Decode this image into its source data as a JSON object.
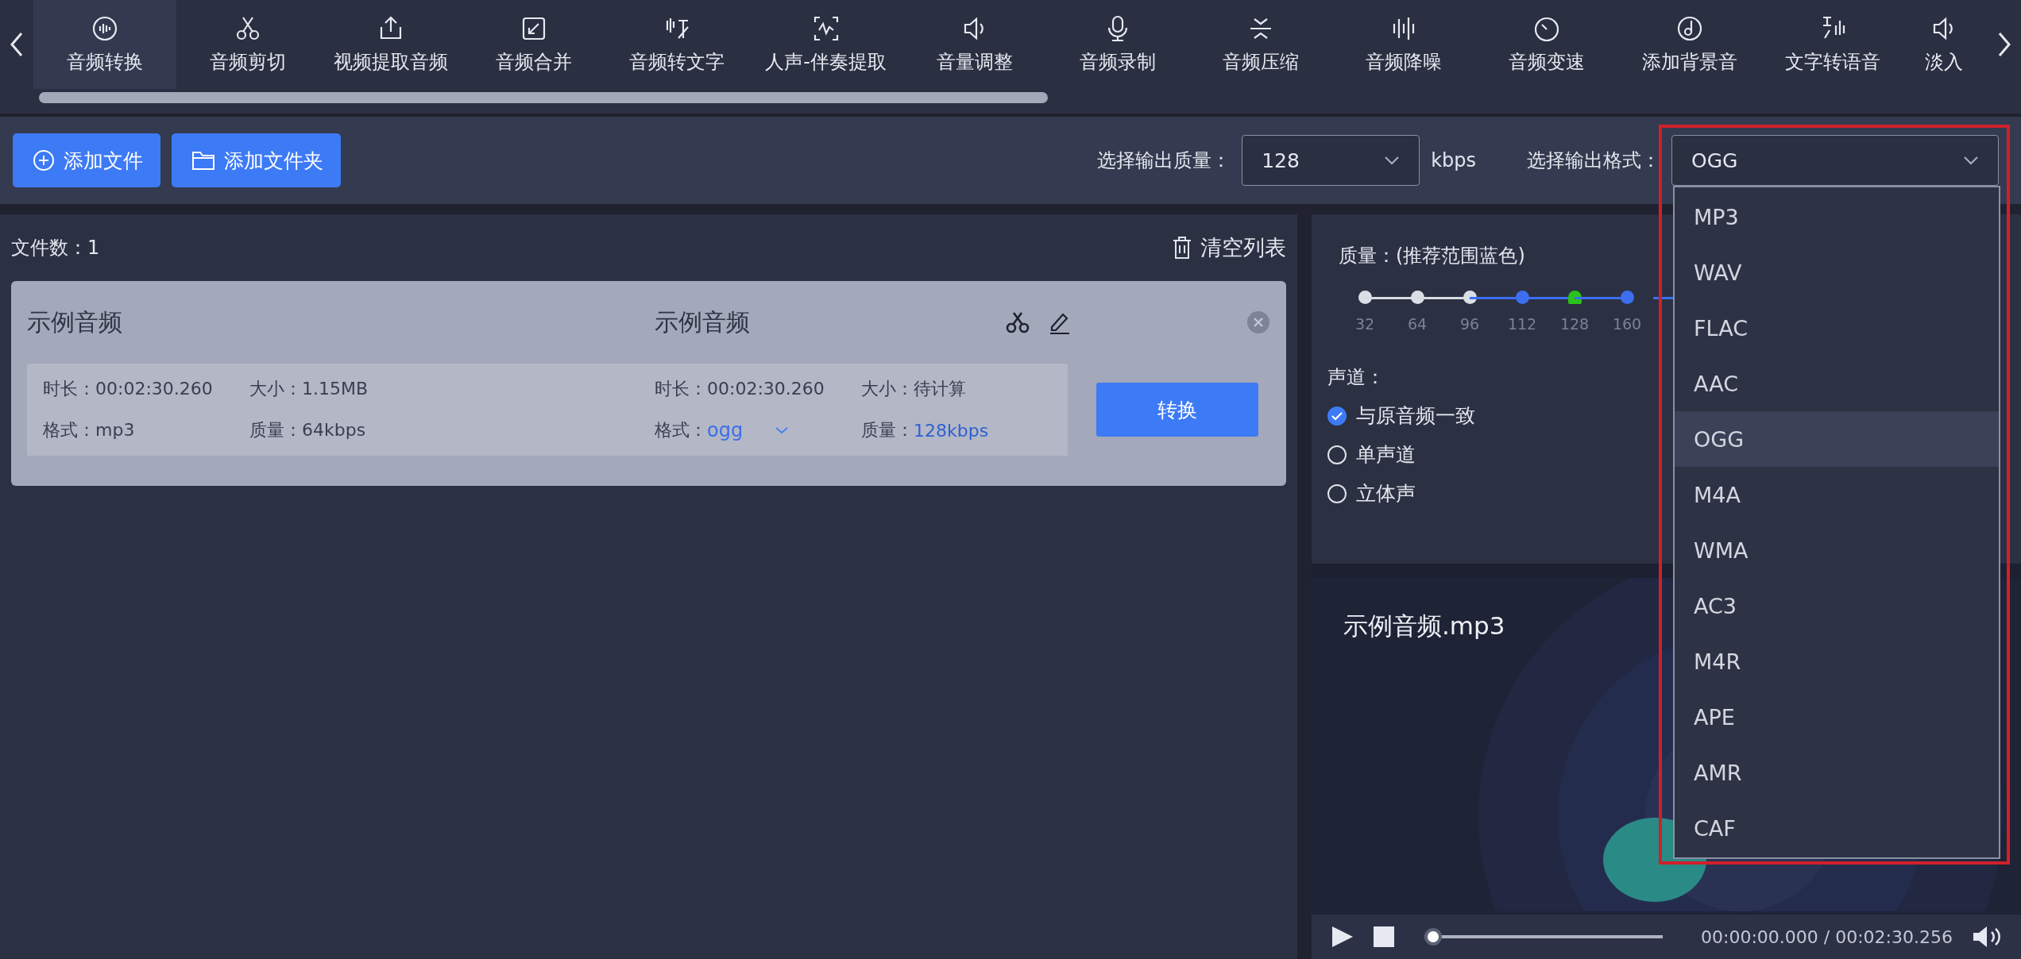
{
  "nav": {
    "tabs": [
      {
        "label": "音频转换",
        "selected": true
      },
      {
        "label": "音频剪切",
        "selected": false
      },
      {
        "label": "视频提取音频",
        "selected": false
      },
      {
        "label": "音频合并",
        "selected": false
      },
      {
        "label": "音频转文字",
        "selected": false
      },
      {
        "label": "人声-伴奏提取",
        "selected": false
      },
      {
        "label": "音量调整",
        "selected": false
      },
      {
        "label": "音频录制",
        "selected": false
      },
      {
        "label": "音频压缩",
        "selected": false
      },
      {
        "label": "音频降噪",
        "selected": false
      },
      {
        "label": "音频变速",
        "selected": false
      },
      {
        "label": "添加背景音",
        "selected": false
      },
      {
        "label": "文字转语音",
        "selected": false
      },
      {
        "label": "淡入",
        "selected": false
      }
    ]
  },
  "toolbar": {
    "add_file": "添加文件",
    "add_folder": "添加文件夹",
    "quality_label": "选择输出质量：",
    "quality_value": "128",
    "quality_unit": "kbps",
    "format_label": "选择输出格式：",
    "format_value": "OGG",
    "format_options": [
      {
        "label": "MP3",
        "selected": false
      },
      {
        "label": "WAV",
        "selected": false
      },
      {
        "label": "FLAC",
        "selected": false
      },
      {
        "label": "AAC",
        "selected": false
      },
      {
        "label": "OGG",
        "selected": true
      },
      {
        "label": "M4A",
        "selected": false
      },
      {
        "label": "WMA",
        "selected": false
      },
      {
        "label": "AC3",
        "selected": false
      },
      {
        "label": "M4R",
        "selected": false
      },
      {
        "label": "APE",
        "selected": false
      },
      {
        "label": "AMR",
        "selected": false
      },
      {
        "label": "CAF",
        "selected": false
      }
    ]
  },
  "file_list": {
    "count": "文件数：1",
    "clear": "清空列表",
    "files": [
      {
        "source": {
          "name": "示例音频",
          "duration": "时长：00:02:30.260",
          "size": "大小：1.15MB",
          "format": "格式：mp3",
          "quality": "质量：64kbps"
        },
        "target": {
          "name": "示例音频",
          "duration": "时长：00:02:30.260",
          "size": "大小：待计算",
          "format_label": "格式：",
          "format": "ogg",
          "quality_label": "质量：",
          "quality": "128kbps"
        },
        "convert": "转换"
      }
    ]
  },
  "settings": {
    "quality_title": "质量：(推荐范围蓝色)",
    "ticks": [
      {
        "label": "32",
        "recommended": false,
        "selected": false
      },
      {
        "label": "64",
        "recommended": false,
        "selected": false
      },
      {
        "label": "96",
        "recommended": false,
        "selected": false
      },
      {
        "label": "112",
        "recommended": true,
        "selected": false
      },
      {
        "label": "128",
        "recommended": true,
        "selected": true
      },
      {
        "label": "160",
        "recommended": true,
        "selected": false
      }
    ],
    "channel_title": "声道：",
    "channels": [
      {
        "label": "与原音频一致",
        "selected": true
      },
      {
        "label": "单声道",
        "selected": false
      },
      {
        "label": "立体声",
        "selected": false
      }
    ]
  },
  "preview": {
    "filename": "示例音频.mp3"
  },
  "player": {
    "level": 0,
    "time": "00:00:00.000 / 00:02:30.256"
  }
}
